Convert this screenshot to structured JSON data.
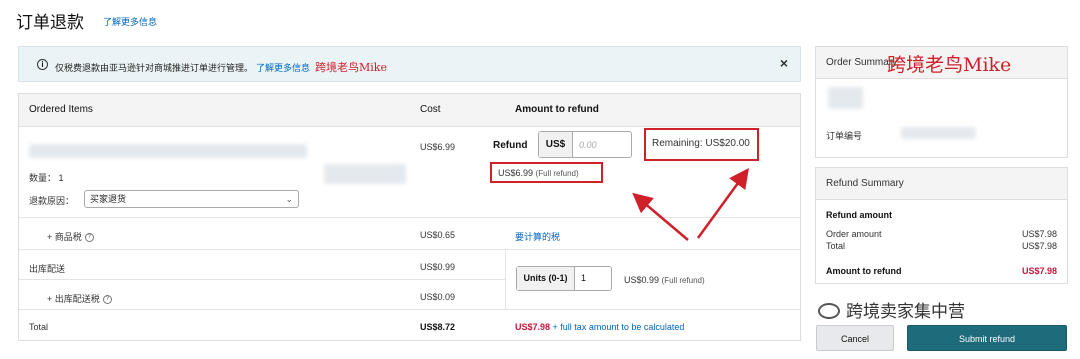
{
  "header": {
    "title": "订单退款",
    "learn_more": "了解更多信息"
  },
  "banner": {
    "text": "仅税费退款由亚马逊针对商城推进订单进行管理。",
    "link": "了解更多信息",
    "watermark": "跨境老鸟Mike",
    "close": "×"
  },
  "table": {
    "headers": {
      "items": "Ordered Items",
      "cost": "Cost",
      "amount": "Amount to refund"
    },
    "item": {
      "qty": "数量： 1",
      "reason_label": "退款原因：",
      "reason_value": "买家退货",
      "cost": "US$6.99",
      "refund_label": "Refund",
      "currency": "US$",
      "placeholder": "0.00",
      "remaining": "Remaining: US$20.00",
      "full_refund_amount": "US$6.99",
      "full_refund_note": "(Full refund)"
    },
    "tax": {
      "label": "+ 商品税",
      "cost": "US$0.65",
      "link": "要计算的税"
    },
    "shipping": {
      "label": "出库配送",
      "cost": "US$0.99",
      "tax_label": "+ 出库配送税",
      "tax_cost": "US$0.09",
      "units_label": "Units (0-1)",
      "units_value": "1",
      "units_refund_amount": "US$0.99",
      "units_refund_note": "(Full refund)"
    },
    "total": {
      "label": "Total",
      "cost": "US$8.72",
      "amount": "US$7.98",
      "note": "+ full tax amount to be calculated"
    }
  },
  "order_summary": {
    "title": "Order Summary",
    "watermark": "跨境老鸟Mike",
    "order_no_label": "订单编号"
  },
  "refund_summary": {
    "title": "Refund Summary",
    "section": "Refund amount",
    "rows": [
      {
        "label": "Order amount",
        "value": "US$7.98"
      },
      {
        "label": "Total",
        "value": "US$7.98"
      }
    ],
    "amount_label": "Amount to refund",
    "amount_value": "US$7.98"
  },
  "buttons": {
    "cancel": "Cancel",
    "submit": "Submit refund"
  },
  "watermark_footer": "跨境卖家集中营",
  "colors": {
    "link": "#0066c0",
    "annotation": "#d0202a",
    "submit": "#1e6b7b",
    "total_red": "#c7163b"
  }
}
